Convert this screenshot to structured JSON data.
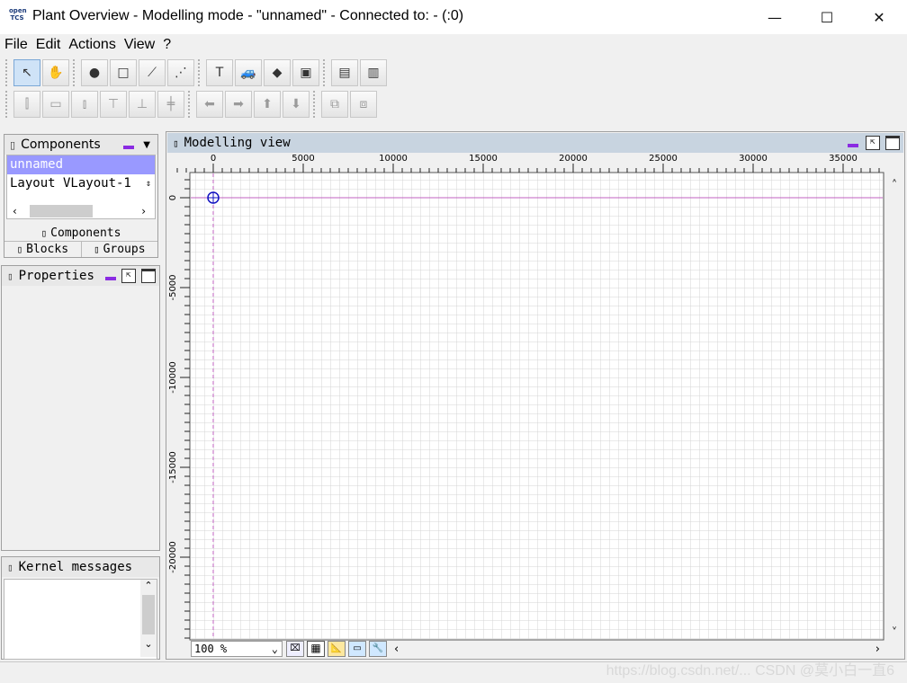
{
  "window": {
    "title": "Plant Overview - Modelling mode - \"unnamed\" - Connected to: - (:0)",
    "logo_text_top": "open",
    "logo_text_bottom": "TCS",
    "minimize_glyph": "—",
    "maximize_glyph": "☐",
    "close_glyph": "✕"
  },
  "menu": [
    "File",
    "Edit",
    "Actions",
    "View",
    "?"
  ],
  "toolbar1": [
    {
      "name": "select-tool-icon",
      "glyph": "↖",
      "active": true
    },
    {
      "name": "pan-hand-icon",
      "glyph": "✋"
    },
    {
      "name": "create-point-icon",
      "glyph": "●"
    },
    {
      "name": "create-location-icon",
      "glyph": "□"
    },
    {
      "name": "create-path-icon",
      "glyph": "⟋"
    },
    {
      "name": "create-link-icon",
      "glyph": "⋰"
    },
    {
      "name": "location-type-icon",
      "glyph": "T"
    },
    {
      "name": "vehicle-icon",
      "glyph": "🚙"
    },
    {
      "name": "blocks-icon",
      "glyph": "◆"
    },
    {
      "name": "groups-icon",
      "glyph": "▣"
    },
    {
      "name": "layer-tool-icon",
      "glyph": "▤"
    },
    {
      "name": "clip-tool-icon",
      "glyph": "▥"
    }
  ],
  "toolbar2": [
    {
      "name": "align-left-icon",
      "glyph": "⫿"
    },
    {
      "name": "align-center-h-icon",
      "glyph": "▭"
    },
    {
      "name": "align-right-icon",
      "glyph": "⫾"
    },
    {
      "name": "align-top-icon",
      "glyph": "⊤"
    },
    {
      "name": "align-bottom-icon",
      "glyph": "⊥"
    },
    {
      "name": "align-center-v-icon",
      "glyph": "╪"
    },
    {
      "name": "move-left-icon",
      "glyph": "⬅"
    },
    {
      "name": "move-right-icon",
      "glyph": "➡"
    },
    {
      "name": "move-up-icon",
      "glyph": "⬆"
    },
    {
      "name": "move-down-icon",
      "glyph": "⬇"
    },
    {
      "name": "bring-front-icon",
      "glyph": "⧉"
    },
    {
      "name": "send-back-icon",
      "glyph": "⧈"
    }
  ],
  "components_panel": {
    "title": "Components",
    "dropdown_glyph": "▼",
    "selected_item": "unnamed",
    "items": [
      "Layout VLayout-1"
    ],
    "tabs": [
      "Components",
      "Blocks",
      "Groups"
    ]
  },
  "properties_panel": {
    "title": "Properties"
  },
  "kernel_panel": {
    "title": "Kernel messages"
  },
  "modelling_view": {
    "title": "Modelling view",
    "x_ticks": [
      "0",
      "5000",
      "10000",
      "15000",
      "20000",
      "25000",
      "30000",
      "35000"
    ],
    "y_ticks": [
      "0",
      "-5000",
      "-10000",
      "-15000",
      "-20000"
    ],
    "zoom": "100 %",
    "zoom_dropdown_glyph": "⌄"
  },
  "watermark": "https://blog.csdn.net/... CSDN @莫小白一直6"
}
